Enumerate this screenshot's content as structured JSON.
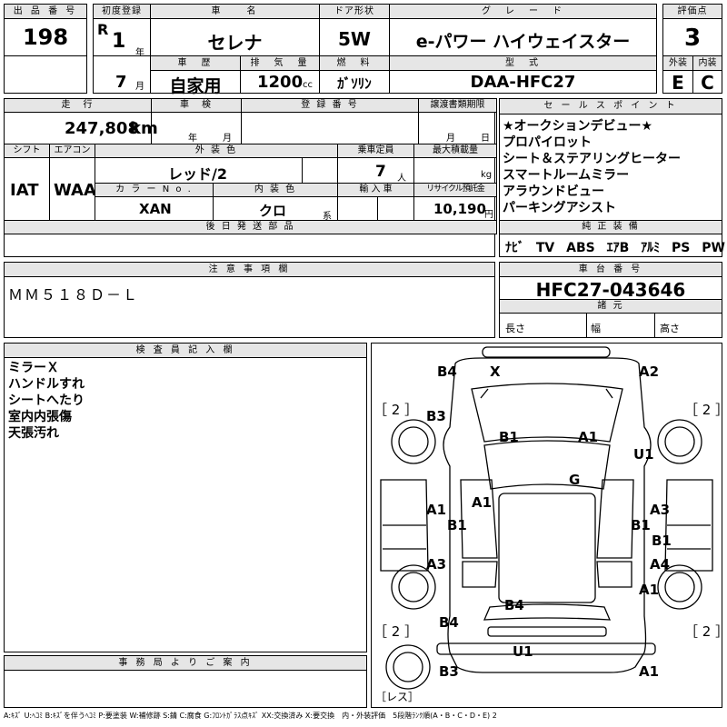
{
  "header": {
    "lot_label": "出 品 番 号",
    "lot": "198",
    "reg_label": "初度登録",
    "era": "R",
    "year": "1",
    "year_unit": "年",
    "month": "7",
    "month_unit": "月",
    "car_name_label": "車　　名",
    "car_name": "セレナ",
    "door_label": "ドア形状",
    "door": "5W",
    "grade_label": "グ　レ　ー　ド",
    "grade": "e-パワー ハイウェイスター",
    "score_label": "評価点",
    "score": "3",
    "history_label": "車　歴",
    "history": "自家用",
    "displacement_label": "排　気　量",
    "displacement": "1200",
    "displacement_unit": "cc",
    "fuel_label": "燃　料",
    "fuel": "ｶﾞｿﾘﾝ",
    "model_label": "型　式",
    "model": "DAA-HFC27",
    "exterior_label": "外装",
    "exterior": "E",
    "interior_label": "内装",
    "interior": "C"
  },
  "details": {
    "mileage_label": "走　行",
    "mileage": "247,808",
    "mileage_unit": "km",
    "inspection_label": "車　検",
    "insp_year_unit": "年",
    "insp_month_unit": "月",
    "regno_label": "登 録 番 号",
    "transfer_label": "譲渡書類期限",
    "transfer_month_unit": "月",
    "transfer_day_unit": "日",
    "shift_label": "シフト",
    "shift": "IAT",
    "ac_label": "エアコン",
    "ac": "WAA",
    "color_label": "外 装 色",
    "color": "レッド/2",
    "capacity_label": "乗車定員",
    "capacity": "7",
    "capacity_unit": "人",
    "load_label": "最大積載量",
    "load_unit": "kg",
    "colorno_label": "カ ラ ー  N o .",
    "colorno": "XAN",
    "interior_color_label": "内 装 色",
    "interior_color": "クロ",
    "interior_color_unit": "系",
    "import_label": "輸 入 車",
    "recycle_label": "リサイクル預託金",
    "recycle": "10,190",
    "recycle_unit": "円",
    "later_label": "後 日 発 送 部 品"
  },
  "sales_points": {
    "label": "セ ー ル ス ポ イ ン ト",
    "items": [
      "★オークションデビュー★",
      "プロパイロット",
      "シート＆ステアリングヒーター",
      "スマートルームミラー",
      "アラウンドビュー",
      "パーキングアシスト"
    ]
  },
  "equipment": {
    "label": "純 正 装 備",
    "items": [
      "ﾅﾋﾞ",
      "TV",
      "ABS",
      "ｴｱB",
      "ｱﾙﾐ",
      "PS",
      "PW"
    ]
  },
  "notes": {
    "label": "注 意 事 項 欄",
    "text": "ＭＭ５１８Ｄ－Ｌ"
  },
  "chassis": {
    "label": "車 台 番 号",
    "number": "HFC27-043646",
    "spec_label": "諸 元",
    "length": "長さ",
    "width": "幅",
    "height": "高さ"
  },
  "inspector": {
    "label": "検 査 員 記 入 欄",
    "lines": [
      "ミラーＸ",
      "ハンドルすれ",
      "シートへたり",
      "室内内張傷",
      "天張汚れ"
    ]
  },
  "office": {
    "label": "事 務 局 よ り ご 案 内"
  },
  "diagram": {
    "marks": {
      "b4_top": "B4",
      "x_top": "X",
      "a2_top": "A2",
      "tire_fl": "［ 2 ］",
      "tire_fr": "［ 2 ］",
      "tire_rl": "［ 2 ］",
      "tire_rr": "［ 2 ］",
      "b3_front_left": "B3",
      "b1_hood": "B1",
      "a1_hood": "A1",
      "u1_front_right": "U1",
      "g_glass": "G",
      "a1_left": "A1",
      "a1_left2": "A1",
      "b1_left": "B1",
      "a3_right": "A3",
      "b1_right": "B1",
      "b1_right2": "B1",
      "a3_left": "A3",
      "a4_right": "A4",
      "a1_right": "A1",
      "b4_rear_center": "B4",
      "b4_rear_left": "B4",
      "u1_rear": "U1",
      "b3_rear_left": "B3",
      "a1_rear_right": "A1",
      "spare": "［レス］"
    }
  },
  "legend": "A:ｷｽﾞ U:ﾍｺﾐ B:ｷｽﾞを伴うﾍｺﾐ P:要塗装 W:補修跡 S:錆 C:腐食 G:ﾌﾛﾝﾄｶﾞﾗｽ点ｷｽﾞ XX:交換済み X:要交換　内・外装評価　5段階ﾗﾝｸ順(A・B・C・D・E) 2"
}
